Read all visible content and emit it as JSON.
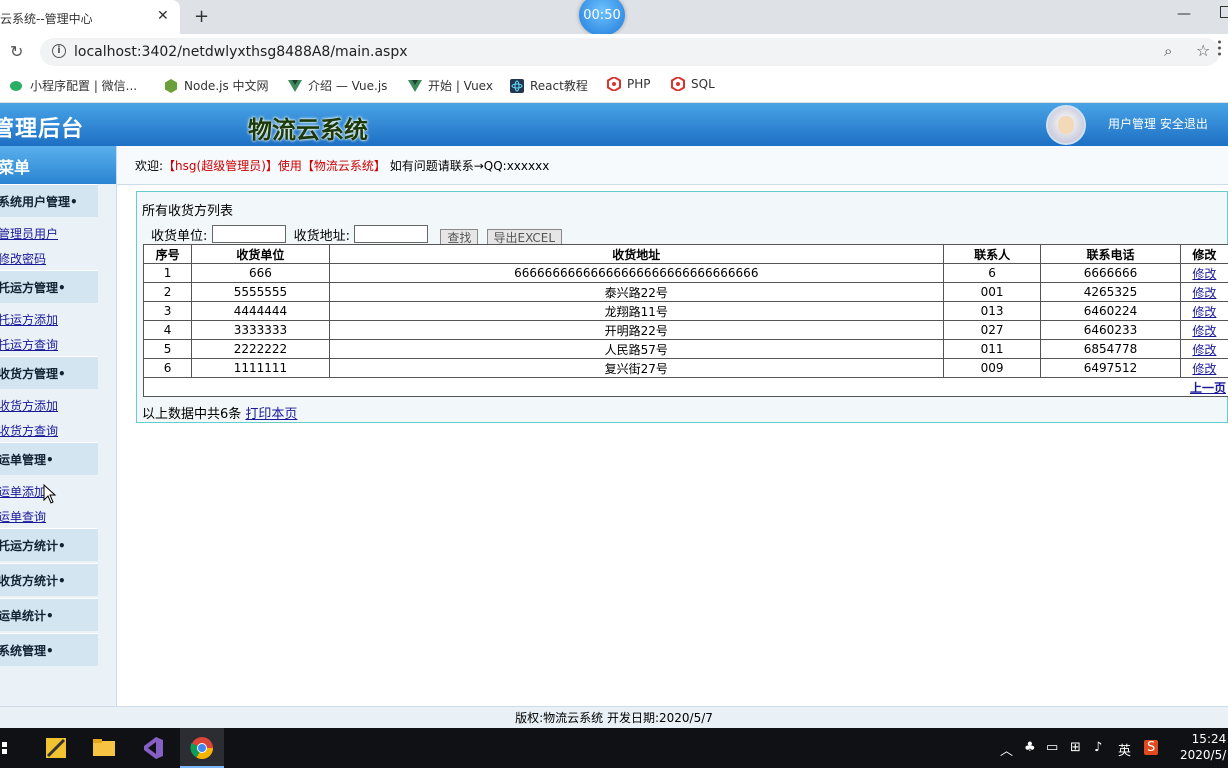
{
  "browser": {
    "tab_title": "云系统--管理中心",
    "rec_time": "00:50",
    "url": "localhost:3402/netdwlyxthsg8488A8/main.aspx",
    "bookmarks": [
      {
        "label": "小程序配置 | 微信...",
        "icon": "wechat-icon",
        "color": "#2aae67"
      },
      {
        "label": "Node.js 中文网",
        "icon": "nodejs-icon",
        "color": "#6a9f3a"
      },
      {
        "label": "介绍 — Vue.js",
        "icon": "vue-icon",
        "color": "#3c8a5a"
      },
      {
        "label": "开始 | Vuex",
        "icon": "vue-icon",
        "color": "#3c8a5a"
      },
      {
        "label": "React教程",
        "icon": "react-icon",
        "color": "#22374f"
      },
      {
        "label": "PHP",
        "icon": "php-icon",
        "color": "#d9352c"
      },
      {
        "label": "SQL",
        "icon": "sql-icon",
        "color": "#d9352c"
      }
    ]
  },
  "header": {
    "admin_title": "管理后台",
    "system_title": "物流云系统",
    "user_mgmt": "用户管理",
    "logout": "安全退出"
  },
  "sidebar": {
    "menu_title": "菜单",
    "groups": [
      {
        "title": "系统用户管理•",
        "links": [
          "管理员用户",
          "修改密码"
        ]
      },
      {
        "title": "托运方管理•",
        "links": [
          "托运方添加",
          "托运方查询"
        ]
      },
      {
        "title": "收货方管理•",
        "links": [
          "收货方添加",
          "收货方查询"
        ]
      },
      {
        "title": "运单管理•",
        "links": [
          "运单添加",
          "运单查询"
        ]
      },
      {
        "title": "托运方统计•",
        "links": []
      },
      {
        "title": "收货方统计•",
        "links": []
      },
      {
        "title": "运单统计•",
        "links": []
      },
      {
        "title": "系统管理•",
        "links": []
      }
    ]
  },
  "welcome": {
    "prefix": "欢迎:",
    "user": "【hsg(超级管理员)】使用【物流云系统】",
    "suffix": "如有问题请联系→QQ:xxxxxx"
  },
  "panel": {
    "title": "所有收货方列表",
    "unit_label": "收货单位:",
    "addr_label": "收货地址:",
    "search_btn": "查找",
    "export_btn": "导出EXCEL",
    "columns": [
      "序号",
      "收货单位",
      "收货地址",
      "联系人",
      "联系电话",
      "修改"
    ],
    "rows": [
      [
        "1",
        "666",
        "66666666666666666666666666666666",
        "6",
        "6666666",
        "修改"
      ],
      [
        "2",
        "5555555",
        "泰兴路22号",
        "001",
        "4265325",
        "修改"
      ],
      [
        "3",
        "4444444",
        "龙翔路11号",
        "013",
        "6460224",
        "修改"
      ],
      [
        "4",
        "3333333",
        "开明路22号",
        "027",
        "6460233",
        "修改"
      ],
      [
        "5",
        "2222222",
        "人民路57号",
        "011",
        "6854778",
        "修改"
      ],
      [
        "6",
        "1111111",
        "复兴街27号",
        "009",
        "6497512",
        "修改"
      ]
    ],
    "pager_prev": "上一页",
    "total_text": "以上数据中共6条",
    "print_link": "打印本页"
  },
  "footer": {
    "copyright": "版权:物流云系统 开发日期:2020/5/7"
  },
  "taskbar": {
    "ime": "英",
    "time": "15:24",
    "date": "2020/5/"
  }
}
